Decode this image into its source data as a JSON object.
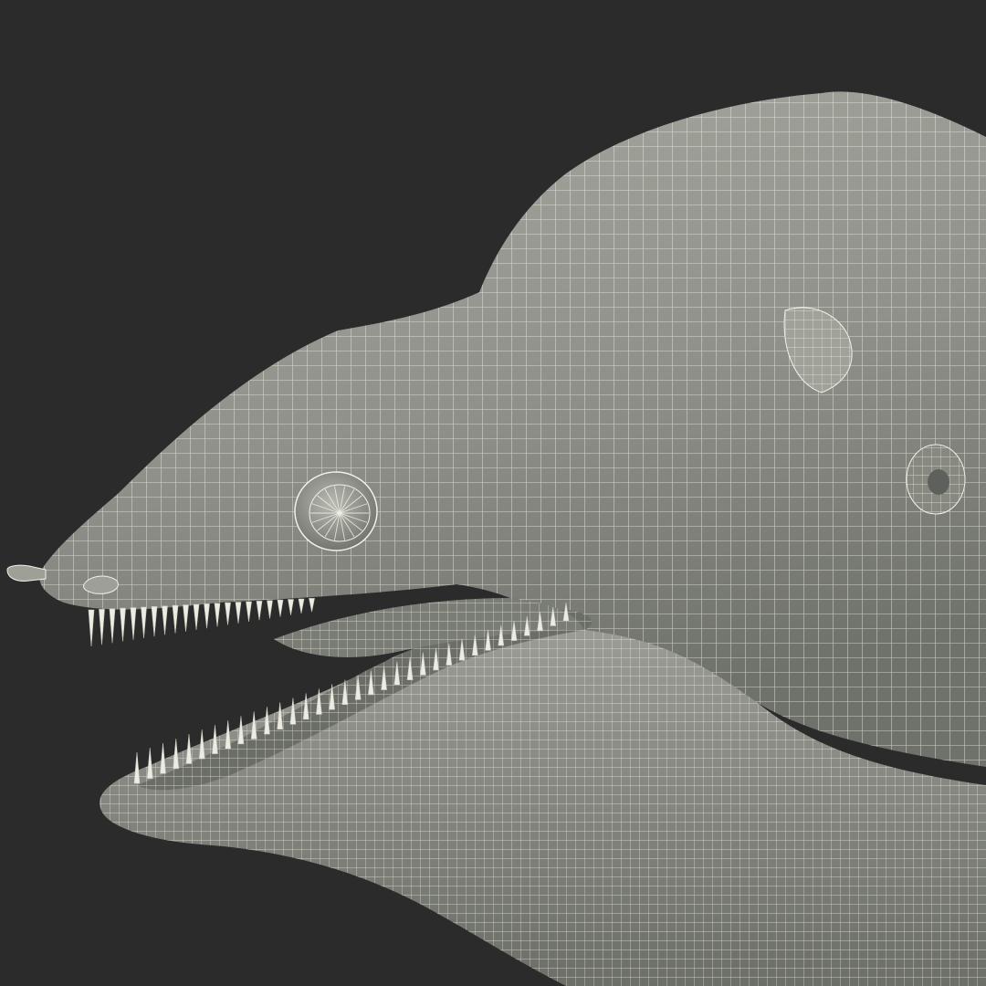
{
  "scene": {
    "subject": "",
    "background_color": "#2b2b2b",
    "surface_color": "#8d8f88",
    "surface_highlight": "#b4b6ae",
    "surface_shadow": "#5e605b",
    "mouth_color": "#6b6d67",
    "wire_color": "#f1f1e6",
    "teeth_color": "#ecece2"
  }
}
